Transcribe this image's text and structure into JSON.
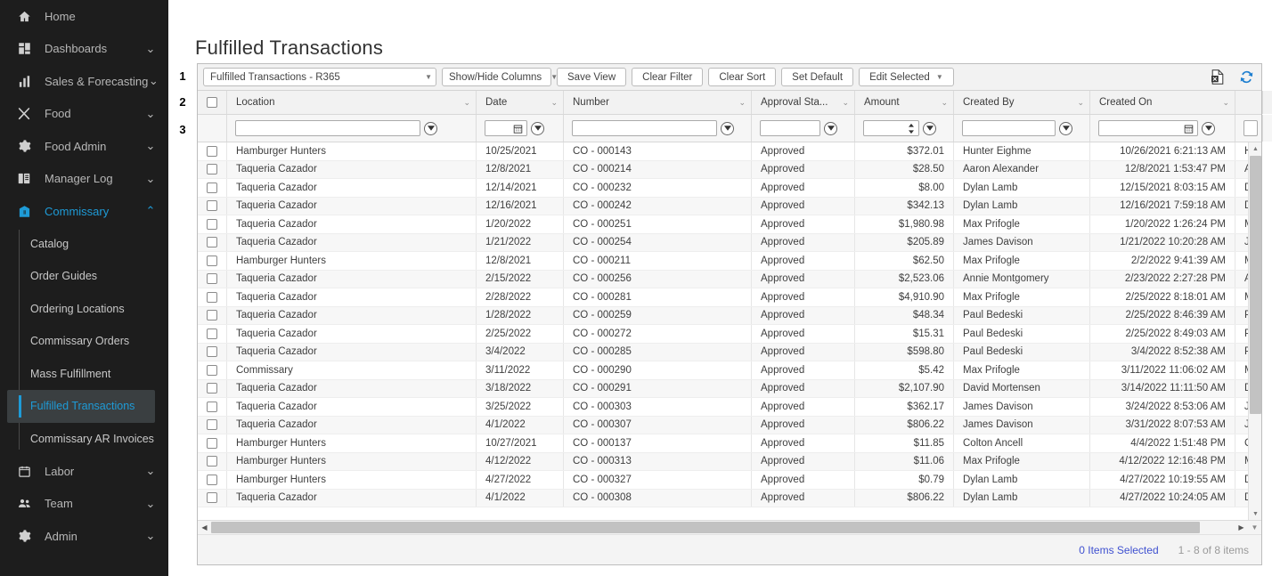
{
  "page": {
    "title": "Fulfilled Transactions"
  },
  "annotations": [
    "1",
    "2",
    "3"
  ],
  "sidebar": {
    "items": [
      {
        "label": "Home",
        "icon": "home-icon",
        "chevron": ""
      },
      {
        "label": "Dashboards",
        "icon": "dashboard-icon",
        "chevron": "⌄"
      },
      {
        "label": "Sales & Forecasting",
        "icon": "bar-chart-icon",
        "chevron": "⌄"
      },
      {
        "label": "Food",
        "icon": "utensils-icon",
        "chevron": "⌄"
      },
      {
        "label": "Food Admin",
        "icon": "gear-icon",
        "chevron": "⌄"
      },
      {
        "label": "Manager Log",
        "icon": "book-icon",
        "chevron": "⌄"
      },
      {
        "label": "Commissary",
        "icon": "commissary-icon",
        "chevron": "⌃",
        "active": true
      }
    ],
    "submenu": [
      {
        "label": "Catalog"
      },
      {
        "label": "Order Guides"
      },
      {
        "label": "Ordering Locations"
      },
      {
        "label": "Commissary Orders"
      },
      {
        "label": "Mass Fulfillment"
      },
      {
        "label": "Fulfilled Transactions",
        "active": true
      },
      {
        "label": "Commissary AR Invoices"
      }
    ],
    "items_bottom": [
      {
        "label": "Labor",
        "icon": "calendar-icon",
        "chevron": "⌄"
      },
      {
        "label": "Team",
        "icon": "people-icon",
        "chevron": "⌄"
      },
      {
        "label": "Admin",
        "icon": "gear-icon",
        "chevron": "⌄"
      }
    ],
    "accent_color": "#1e9bd7",
    "bg_color": "#1d1d1d"
  },
  "toolbar": {
    "view_select": {
      "value": "Fulfilled Transactions - R365",
      "caret": "▼"
    },
    "showhide_select": {
      "value": "Show/Hide Columns",
      "caret": "▼"
    },
    "buttons": [
      {
        "label": "Save View"
      },
      {
        "label": "Clear Filter"
      },
      {
        "label": "Clear Sort"
      },
      {
        "label": "Set Default"
      },
      {
        "label": "Edit Selected",
        "caret": "▼"
      }
    ],
    "icons": [
      {
        "name": "export-excel-icon"
      },
      {
        "name": "refresh-icon",
        "color": "#1e7fd0"
      }
    ]
  },
  "grid": {
    "columns": [
      {
        "key": "check",
        "label": "",
        "chevron": ""
      },
      {
        "key": "location",
        "label": "Location",
        "chevron": "⌄"
      },
      {
        "key": "date",
        "label": "Date",
        "chevron": "⌄"
      },
      {
        "key": "number",
        "label": "Number",
        "chevron": "⌄"
      },
      {
        "key": "approval",
        "label": "Approval Sta...",
        "chevron": "⌄"
      },
      {
        "key": "amount",
        "label": "Amount",
        "chevron": "⌄"
      },
      {
        "key": "createdby",
        "label": "Created By",
        "chevron": "⌄"
      },
      {
        "key": "createdon",
        "label": "Created On",
        "chevron": "⌄"
      },
      {
        "key": "extra",
        "label": "",
        "chevron": ""
      }
    ],
    "filter_placeholder": "",
    "rows": [
      {
        "location": "Hamburger Hunters",
        "date": "10/25/2021",
        "number": "CO - 000143",
        "approval": "Approved",
        "amount": "$372.01",
        "created_by": "Hunter Eighme",
        "created_on": "10/26/2021 6:21:13 AM",
        "extra": "H"
      },
      {
        "location": "Taqueria Cazador",
        "date": "12/8/2021",
        "number": "CO - 000214",
        "approval": "Approved",
        "amount": "$28.50",
        "created_by": "Aaron Alexander",
        "created_on": "12/8/2021 1:53:47 PM",
        "extra": "A"
      },
      {
        "location": "Taqueria Cazador",
        "date": "12/14/2021",
        "number": "CO - 000232",
        "approval": "Approved",
        "amount": "$8.00",
        "created_by": "Dylan Lamb",
        "created_on": "12/15/2021 8:03:15 AM",
        "extra": "D"
      },
      {
        "location": "Taqueria Cazador",
        "date": "12/16/2021",
        "number": "CO - 000242",
        "approval": "Approved",
        "amount": "$342.13",
        "created_by": "Dylan Lamb",
        "created_on": "12/16/2021 7:59:18 AM",
        "extra": "D"
      },
      {
        "location": "Taqueria Cazador",
        "date": "1/20/2022",
        "number": "CO - 000251",
        "approval": "Approved",
        "amount": "$1,980.98",
        "created_by": "Max Prifogle",
        "created_on": "1/20/2022 1:26:24 PM",
        "extra": "M"
      },
      {
        "location": "Taqueria Cazador",
        "date": "1/21/2022",
        "number": "CO - 000254",
        "approval": "Approved",
        "amount": "$205.89",
        "created_by": "James Davison",
        "created_on": "1/21/2022 10:20:28 AM",
        "extra": "J"
      },
      {
        "location": "Hamburger Hunters",
        "date": "12/8/2021",
        "number": "CO - 000211",
        "approval": "Approved",
        "amount": "$62.50",
        "created_by": "Max Prifogle",
        "created_on": "2/2/2022 9:41:39 AM",
        "extra": "M"
      },
      {
        "location": "Taqueria Cazador",
        "date": "2/15/2022",
        "number": "CO - 000256",
        "approval": "Approved",
        "amount": "$2,523.06",
        "created_by": "Annie Montgomery",
        "created_on": "2/23/2022 2:27:28 PM",
        "extra": "A"
      },
      {
        "location": "Taqueria Cazador",
        "date": "2/28/2022",
        "number": "CO - 000281",
        "approval": "Approved",
        "amount": "$4,910.90",
        "created_by": "Max Prifogle",
        "created_on": "2/25/2022 8:18:01 AM",
        "extra": "M"
      },
      {
        "location": "Taqueria Cazador",
        "date": "1/28/2022",
        "number": "CO - 000259",
        "approval": "Approved",
        "amount": "$48.34",
        "created_by": "Paul Bedeski",
        "created_on": "2/25/2022 8:46:39 AM",
        "extra": "P"
      },
      {
        "location": "Taqueria Cazador",
        "date": "2/25/2022",
        "number": "CO - 000272",
        "approval": "Approved",
        "amount": "$15.31",
        "created_by": "Paul Bedeski",
        "created_on": "2/25/2022 8:49:03 AM",
        "extra": "P"
      },
      {
        "location": "Taqueria Cazador",
        "date": "3/4/2022",
        "number": "CO - 000285",
        "approval": "Approved",
        "amount": "$598.80",
        "created_by": "Paul Bedeski",
        "created_on": "3/4/2022 8:52:38 AM",
        "extra": "P"
      },
      {
        "location": "Commissary",
        "date": "3/11/2022",
        "number": "CO - 000290",
        "approval": "Approved",
        "amount": "$5.42",
        "created_by": "Max Prifogle",
        "created_on": "3/11/2022 11:06:02 AM",
        "extra": "M"
      },
      {
        "location": "Taqueria Cazador",
        "date": "3/18/2022",
        "number": "CO - 000291",
        "approval": "Approved",
        "amount": "$2,107.90",
        "created_by": "David Mortensen",
        "created_on": "3/14/2022 11:11:50 AM",
        "extra": "D"
      },
      {
        "location": "Taqueria Cazador",
        "date": "3/25/2022",
        "number": "CO - 000303",
        "approval": "Approved",
        "amount": "$362.17",
        "created_by": "James Davison",
        "created_on": "3/24/2022 8:53:06 AM",
        "extra": "J"
      },
      {
        "location": "Taqueria Cazador",
        "date": "4/1/2022",
        "number": "CO - 000307",
        "approval": "Approved",
        "amount": "$806.22",
        "created_by": "James Davison",
        "created_on": "3/31/2022 8:07:53 AM",
        "extra": "J"
      },
      {
        "location": "Hamburger Hunters",
        "date": "10/27/2021",
        "number": "CO - 000137",
        "approval": "Approved",
        "amount": "$11.85",
        "created_by": "Colton Ancell",
        "created_on": "4/4/2022 1:51:48 PM",
        "extra": "C"
      },
      {
        "location": "Hamburger Hunters",
        "date": "4/12/2022",
        "number": "CO - 000313",
        "approval": "Approved",
        "amount": "$11.06",
        "created_by": "Max Prifogle",
        "created_on": "4/12/2022 12:16:48 PM",
        "extra": "M"
      },
      {
        "location": "Hamburger Hunters",
        "date": "4/27/2022",
        "number": "CO - 000327",
        "approval": "Approved",
        "amount": "$0.79",
        "created_by": "Dylan Lamb",
        "created_on": "4/27/2022 10:19:55 AM",
        "extra": "D"
      },
      {
        "location": "Taqueria Cazador",
        "date": "4/1/2022",
        "number": "CO - 000308",
        "approval": "Approved",
        "amount": "$806.22",
        "created_by": "Dylan Lamb",
        "created_on": "4/27/2022 10:24:05 AM",
        "extra": "D"
      }
    ]
  },
  "footer": {
    "items_selected": "0 Items Selected",
    "items_range": "1 - 8 of 8 items"
  }
}
